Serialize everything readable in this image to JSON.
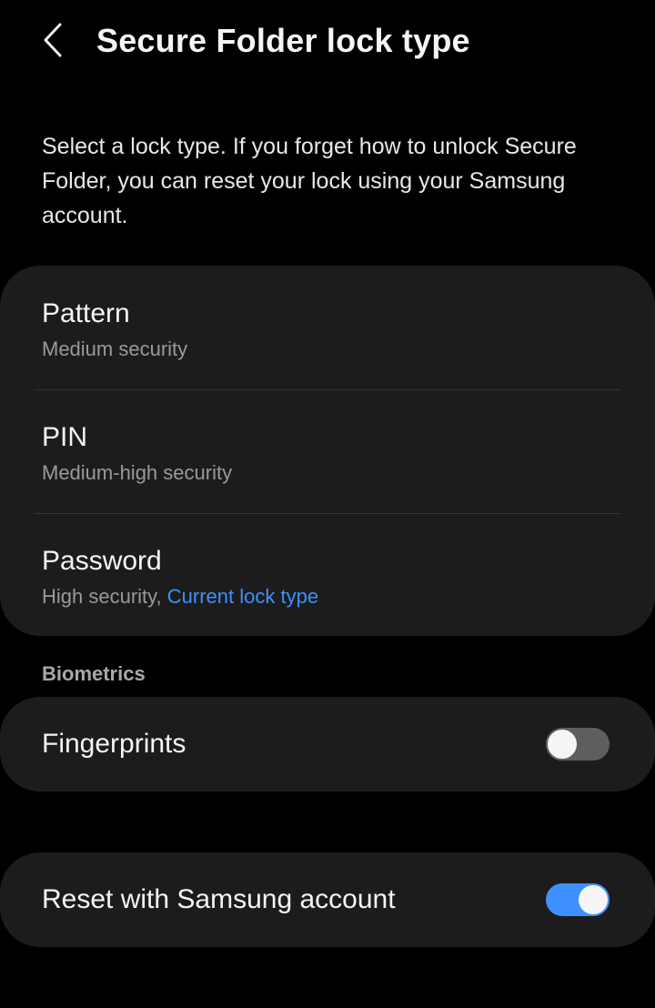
{
  "header": {
    "title": "Secure Folder lock type",
    "back_icon": "chevron-left-icon"
  },
  "description": "Select a lock type. If you forget how to unlock Secure Folder, you can reset your lock using your Samsung account.",
  "lock_options": [
    {
      "title": "Pattern",
      "subtitle": "Medium security",
      "current": ""
    },
    {
      "title": "PIN",
      "subtitle": "Medium-high security",
      "current": ""
    },
    {
      "title": "Password",
      "subtitle": "High security,",
      "current": "Current lock type"
    }
  ],
  "biometrics": {
    "section_label": "Biometrics",
    "fingerprints": {
      "label": "Fingerprints",
      "enabled": false
    }
  },
  "reset": {
    "label": "Reset with Samsung account",
    "enabled": true
  },
  "colors": {
    "background": "#000000",
    "card": "#1c1c1c",
    "accent": "#3e91ff",
    "switch_off": "#5e5e5e"
  }
}
